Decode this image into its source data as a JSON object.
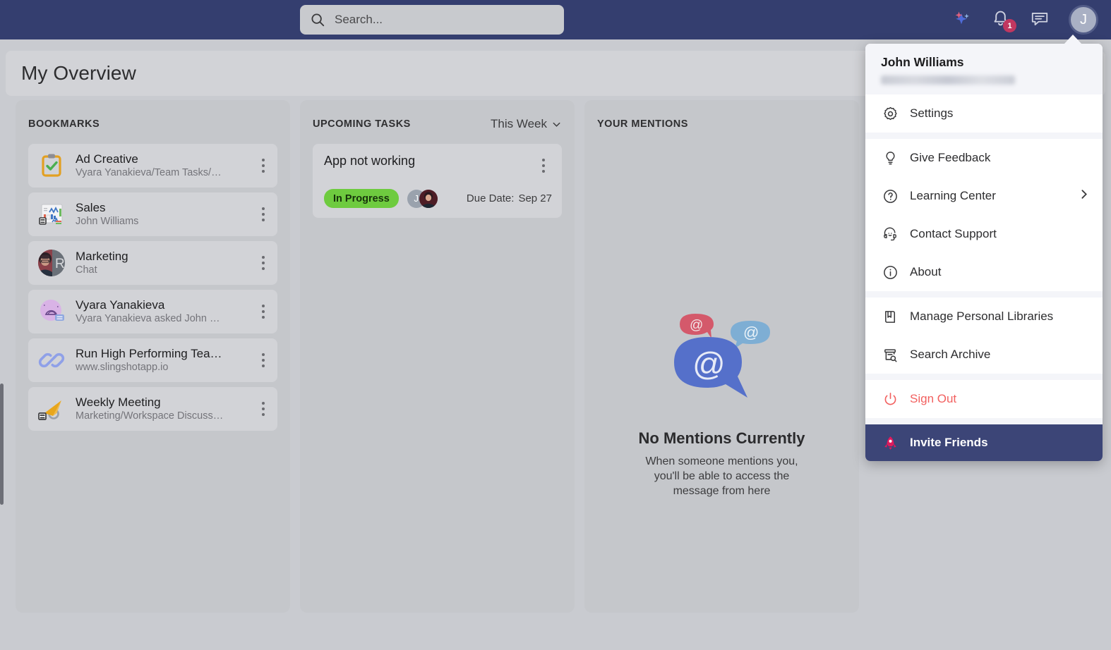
{
  "topbar": {
    "search": {
      "placeholder": "Search...",
      "value": "",
      "icon": "search-icon"
    },
    "ai_icon": "sparkles-icon",
    "notifications": {
      "icon": "bell-icon",
      "count": "1"
    },
    "messages": {
      "icon": "chat-bubble-icon"
    },
    "avatar": {
      "initial": "J"
    }
  },
  "page": {
    "title": "My Overview"
  },
  "bookmarks": {
    "heading": "BOOKMARKS",
    "items": [
      {
        "title": "Ad Creative",
        "subtitle": "Vyara Yanakieva/Team Tasks/…",
        "icon": "clipboard-check-icon",
        "menu_icon": "kebab-menu-icon"
      },
      {
        "title": "Sales",
        "subtitle": "John Williams",
        "icon": "dashboard-chart-icon",
        "menu_icon": "kebab-menu-icon"
      },
      {
        "title": "Marketing",
        "subtitle": "Chat",
        "icon": "avatar-photo-icon",
        "menu_icon": "kebab-menu-icon"
      },
      {
        "title": "Vyara Yanakieva",
        "subtitle": "Vyara Yanakieva asked John …",
        "icon": "idea-bubble-icon",
        "menu_icon": "kebab-menu-icon"
      },
      {
        "title": "Run High Performing Tea…",
        "subtitle": "www.slingshotapp.io",
        "icon": "link-icon",
        "menu_icon": "kebab-menu-icon"
      },
      {
        "title": "Weekly Meeting",
        "subtitle": "Marketing/Workspace Discuss…",
        "icon": "megaphone-icon",
        "menu_icon": "kebab-menu-icon"
      }
    ]
  },
  "tasks": {
    "heading": "UPCOMING TASKS",
    "filter_label": "This Week",
    "filter_icon": "chevron-down-icon",
    "items": [
      {
        "name": "App not working",
        "status": "In Progress",
        "status_color": "#6ecb3f",
        "due_label": "Due Date:",
        "due_value": "Sep 27",
        "menu_icon": "kebab-menu-icon",
        "assignees": [
          {
            "initial": "J",
            "color": "#9aa2ad"
          },
          {
            "initial": "",
            "color": "#5a2530"
          }
        ]
      }
    ]
  },
  "mentions": {
    "heading": "YOUR MENTIONS",
    "empty_icon": "at-mention-bubbles-icon",
    "empty_title": "No Mentions Currently",
    "empty_text": "When someone mentions you, you'll be able to access the message from here"
  },
  "profile_menu": {
    "user_name": "John Williams",
    "user_email_redacted": true,
    "groups": [
      [
        {
          "label": "Settings",
          "icon": "gear-icon"
        }
      ],
      [
        {
          "label": "Give Feedback",
          "icon": "lightbulb-icon"
        },
        {
          "label": "Learning Center",
          "icon": "question-circle-icon",
          "arrow_icon": "chevron-right-icon"
        },
        {
          "label": "Contact Support",
          "icon": "headset-support-icon"
        },
        {
          "label": "About",
          "icon": "info-circle-icon"
        }
      ],
      [
        {
          "label": "Manage Personal Libraries",
          "icon": "book-icon"
        },
        {
          "label": "Search Archive",
          "icon": "archive-search-icon"
        }
      ],
      [
        {
          "label": "Sign Out",
          "icon": "power-icon",
          "color": "#f2605f"
        }
      ]
    ],
    "invite": {
      "label": "Invite Friends",
      "icon": "rocket-icon",
      "bg": "#3c4577"
    }
  },
  "colors": {
    "topbar_bg": "#343e6f",
    "page_bg": "#c9cbd0",
    "panel_bg": "#c5c7cb",
    "card_bg": "#d2d3d7",
    "accent": "#3c4577",
    "badge": "#c13760",
    "status_green": "#6ecb3f",
    "signout_red": "#f2605f"
  }
}
